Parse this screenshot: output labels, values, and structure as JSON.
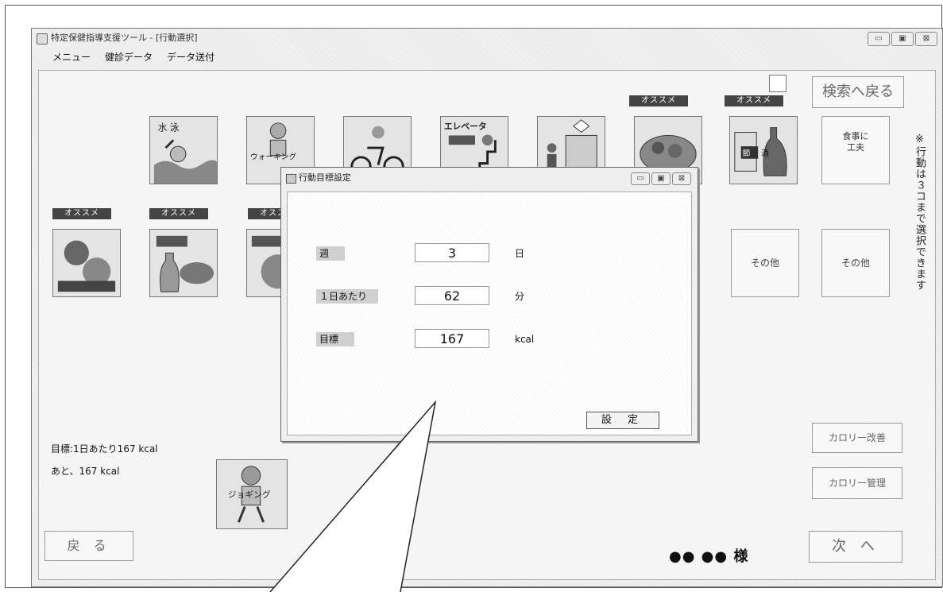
{
  "window": {
    "title": "特定保健指導支援ツール - [行動選択]",
    "controls": [
      "▭",
      "▣",
      "⊠"
    ]
  },
  "menu": {
    "items": [
      "メニュー",
      "健診データ",
      "データ送付"
    ]
  },
  "top_right": {
    "search_back": "検索へ戻る"
  },
  "badge_label": "オススメ",
  "tiles": {
    "swim": "水 泳",
    "walking": "ウォーキング",
    "cycling": "サイクリング",
    "elevator": "エレベータ",
    "train": "電車",
    "food": "食事",
    "alcohol": "節 酒",
    "meal_improve": "食事に\n工夫",
    "snack": "おやつを控える",
    "drink": "飲み物",
    "meal2": "食事量",
    "other1": "その他",
    "other2": "その他",
    "jogging": "ジョギング"
  },
  "side_note": "※行動は３コまで選択できます",
  "status": {
    "target": "目標:1日あたり167 kcal",
    "remaining": "あと、167 kcal"
  },
  "buttons": {
    "calorie_ranking": "カロリー改善",
    "calorie_manage": "カロリー管理",
    "back": "戻 る",
    "next": "次 へ"
  },
  "user": {
    "name": "●● ●● 様"
  },
  "dialog": {
    "title": "行動目標設定",
    "controls": [
      "▭",
      "▣",
      "⊠"
    ],
    "fields": [
      {
        "label": "週",
        "value": "3",
        "unit": "日"
      },
      {
        "label": "１日あたり",
        "value": "62",
        "unit": "分"
      },
      {
        "label": "目標",
        "value": "167",
        "unit": "kcal"
      }
    ],
    "set_label": "設 定"
  }
}
